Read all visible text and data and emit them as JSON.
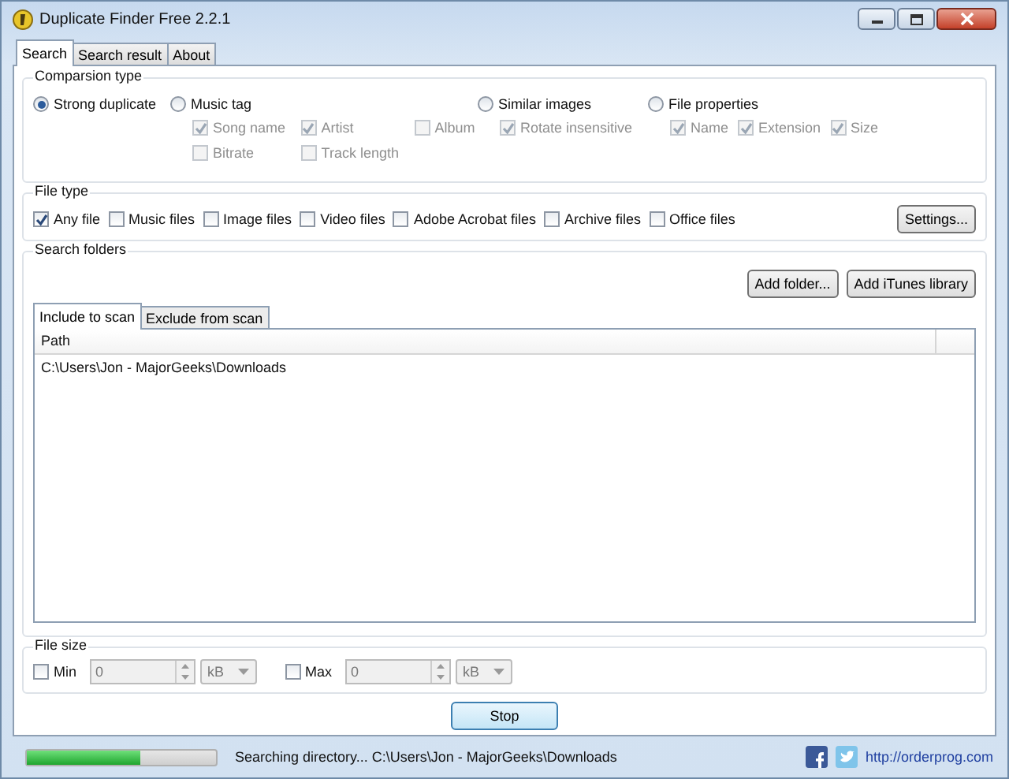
{
  "window": {
    "title": "Duplicate Finder Free 2.2.1"
  },
  "tabs": [
    {
      "label": "Search",
      "selected": true
    },
    {
      "label": "Search result",
      "selected": false
    },
    {
      "label": "About",
      "selected": false
    }
  ],
  "comparison": {
    "title": "Comparsion type",
    "options": [
      {
        "label": "Strong duplicate",
        "selected": true
      },
      {
        "label": "Music tag",
        "selected": false,
        "children": [
          {
            "label": "Song name",
            "checked": true,
            "disabled": true
          },
          {
            "label": "Artist",
            "checked": true,
            "disabled": true
          },
          {
            "label": "Album",
            "checked": false,
            "disabled": true
          },
          {
            "label": "Bitrate",
            "checked": false,
            "disabled": true
          },
          {
            "label": "Track length",
            "checked": false,
            "disabled": true
          }
        ]
      },
      {
        "label": "Similar images",
        "selected": false,
        "children": [
          {
            "label": "Rotate insensitive",
            "checked": true,
            "disabled": true
          }
        ]
      },
      {
        "label": "File properties",
        "selected": false,
        "children": [
          {
            "label": "Name",
            "checked": true,
            "disabled": true
          },
          {
            "label": "Extension",
            "checked": true,
            "disabled": true
          },
          {
            "label": "Size",
            "checked": true,
            "disabled": true
          }
        ]
      }
    ]
  },
  "file_type": {
    "title": "File type",
    "options": [
      {
        "label": "Any file",
        "checked": true
      },
      {
        "label": "Music files",
        "checked": false
      },
      {
        "label": "Image files",
        "checked": false
      },
      {
        "label": "Video files",
        "checked": false
      },
      {
        "label": "Adobe Acrobat files",
        "checked": false
      },
      {
        "label": "Archive files",
        "checked": false
      },
      {
        "label": "Office files",
        "checked": false
      }
    ],
    "button": "Settings..."
  },
  "search_folders": {
    "title": "Search folders",
    "buttons": [
      "Add folder...",
      "Add iTunes library"
    ],
    "tabs": [
      {
        "label": "Include to scan",
        "selected": true
      },
      {
        "label": "Exclude from scan",
        "selected": false
      }
    ],
    "columns": [
      "Path"
    ],
    "rows": [
      "C:\\Users\\Jon - MajorGeeks\\Downloads"
    ]
  },
  "file_size": {
    "title": "File size",
    "limits": [
      {
        "label": "Min",
        "checked": false,
        "value": "0",
        "unit": "kB",
        "disabled": true
      },
      {
        "label": "Max",
        "checked": false,
        "value": "0",
        "unit": "kB",
        "disabled": true
      }
    ]
  },
  "action_button": "Stop",
  "status_bar": {
    "level": 0.6,
    "message": "Searching directory... C:\\Users\\Jon - MajorGeeks\\Downloads",
    "link": "http://orderprog.com"
  }
}
